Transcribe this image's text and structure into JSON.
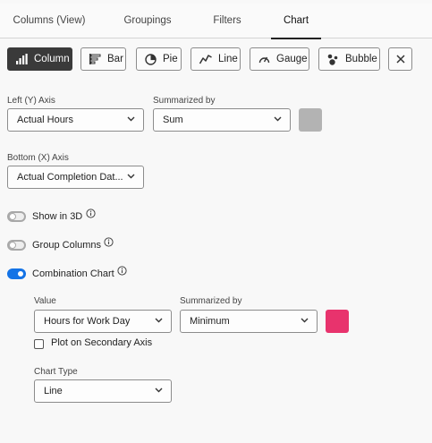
{
  "tabs": [
    {
      "label": "Columns (View)"
    },
    {
      "label": "Groupings"
    },
    {
      "label": "Filters"
    },
    {
      "label": "Chart"
    }
  ],
  "chart_types": [
    {
      "label": "Column",
      "icon": "column-chart-icon",
      "active": true
    },
    {
      "label": "Bar",
      "icon": "bar-chart-icon"
    },
    {
      "label": "Pie",
      "icon": "pie-chart-icon"
    },
    {
      "label": "Line",
      "icon": "line-chart-icon"
    },
    {
      "label": "Gauge",
      "icon": "gauge-icon"
    },
    {
      "label": "Bubble",
      "icon": "bubble-chart-icon"
    }
  ],
  "left_axis": {
    "label": "Left (Y) Axis",
    "value": "Actual Hours"
  },
  "summarized": {
    "label": "Summarized by",
    "value": "Sum",
    "color": "#b3b3b3"
  },
  "bottom_axis": {
    "label": "Bottom (X) Axis",
    "value": "Actual Completion Dat..."
  },
  "toggles": {
    "show3d": {
      "label": "Show in 3D",
      "on": false
    },
    "group_columns": {
      "label": "Group Columns",
      "on": false
    },
    "combination": {
      "label": "Combination Chart",
      "on": true
    }
  },
  "combo": {
    "value_label": "Value",
    "value": "Hours for Work Day",
    "summarized_label": "Summarized by",
    "summarized_value": "Minimum",
    "color": "#e8336d",
    "secondary_axis_label": "Plot on Secondary Axis",
    "chart_type_label": "Chart Type",
    "chart_type_value": "Line"
  },
  "colors": {
    "accent": "#1473e6",
    "active_button": "#3a3a3a"
  }
}
